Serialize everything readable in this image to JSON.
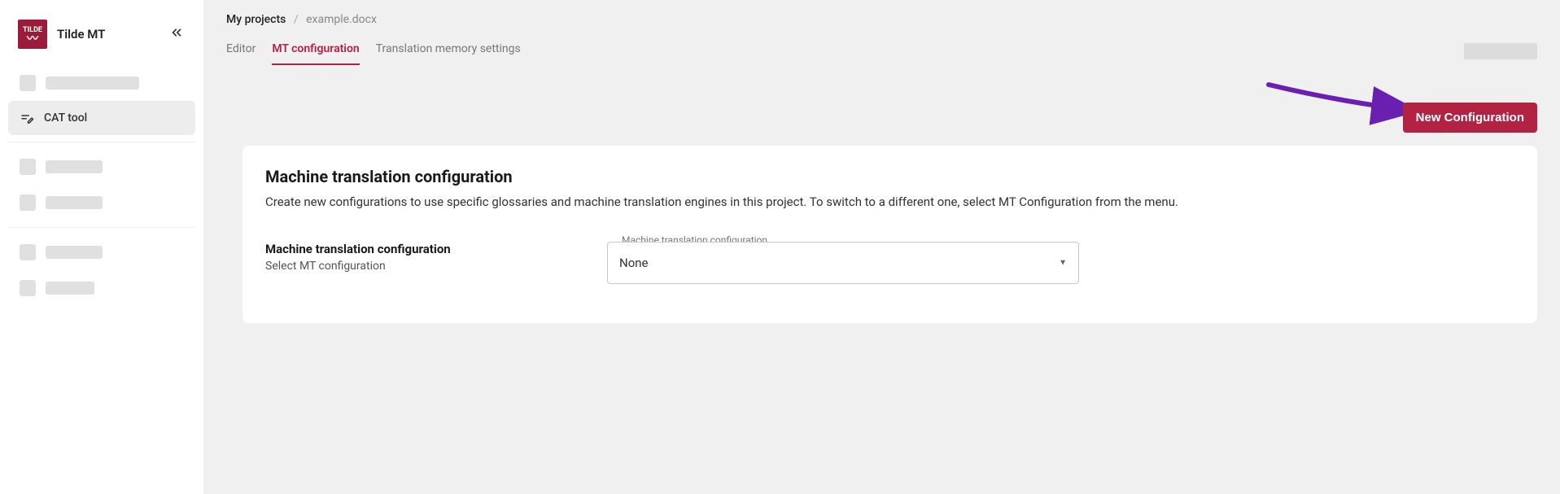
{
  "sidebar": {
    "brand_name": "Tilde MT",
    "logo_text": "TILDE",
    "nav": {
      "cat_tool": "CAT tool"
    }
  },
  "breadcrumb": {
    "root": "My projects",
    "sep": "/",
    "leaf": "example.docx"
  },
  "tabs": {
    "editor": "Editor",
    "mt_config": "MT configuration",
    "tm_settings": "Translation memory settings"
  },
  "actions": {
    "new_config": "New Configuration"
  },
  "card": {
    "heading": "Machine translation configuration",
    "description": "Create new configurations to use specific glossaries and machine translation engines in this project. To switch to a different one, select MT Configuration from the menu.",
    "field_title": "Machine translation configuration",
    "field_subtitle": "Select MT configuration",
    "select_label": "Machine translation configuration",
    "select_value": "None"
  }
}
